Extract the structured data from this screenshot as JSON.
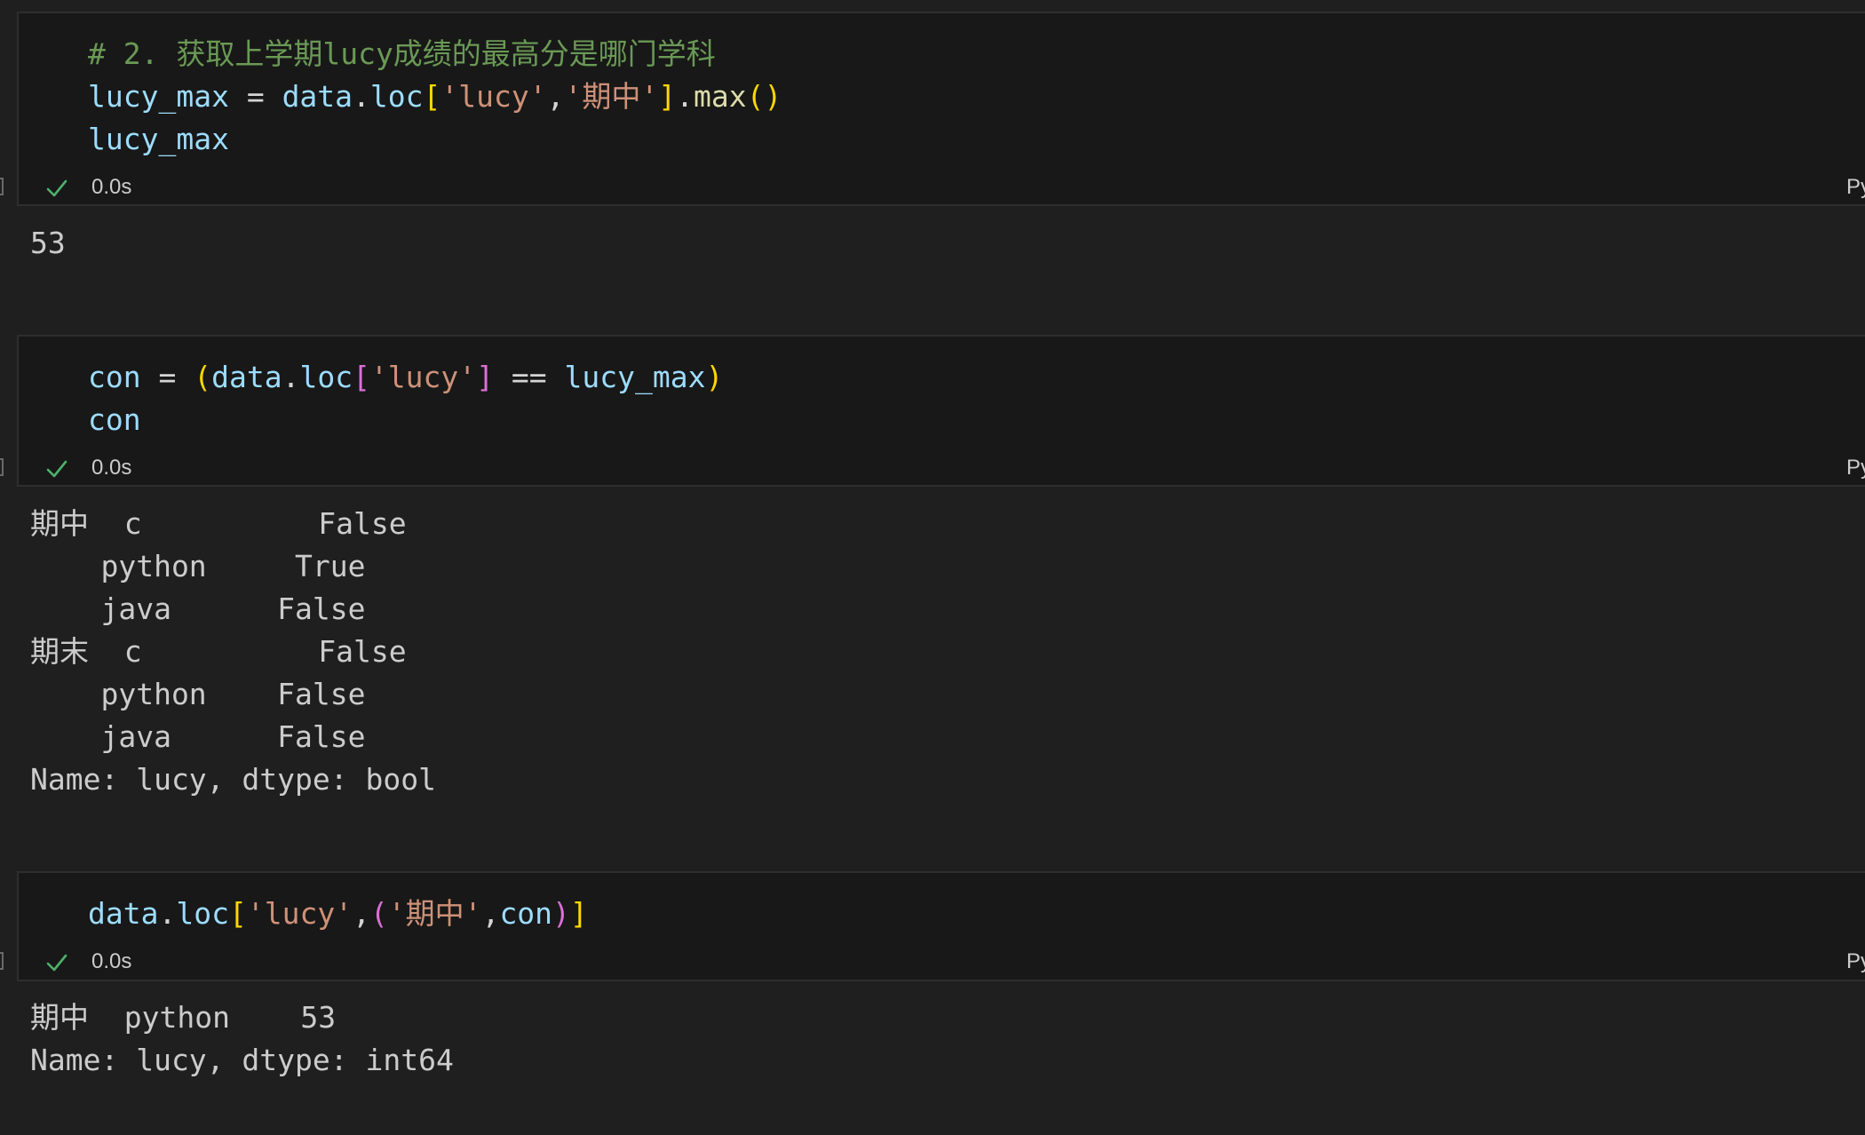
{
  "cells": [
    {
      "code_lines": [
        [
          {
            "text": "# 2. 获取上学期lucy成绩的最高分是哪门学科",
            "kind": "comment"
          }
        ],
        [
          {
            "text": "lucy_max",
            "kind": "var"
          },
          {
            "text": " = ",
            "kind": "op"
          },
          {
            "text": "data",
            "kind": "var"
          },
          {
            "text": ".",
            "kind": "plain"
          },
          {
            "text": "loc",
            "kind": "var"
          },
          {
            "text": "[",
            "kind": "b1"
          },
          {
            "text": "'lucy'",
            "kind": "str"
          },
          {
            "text": ",",
            "kind": "plain"
          },
          {
            "text": "'期中'",
            "kind": "str"
          },
          {
            "text": "]",
            "kind": "b1"
          },
          {
            "text": ".",
            "kind": "plain"
          },
          {
            "text": "max",
            "kind": "fn"
          },
          {
            "text": "()",
            "kind": "b1"
          }
        ],
        [
          {
            "text": "lucy_max",
            "kind": "var"
          }
        ]
      ],
      "status": {
        "elapsed": "0.0s",
        "language": "Py"
      },
      "output_lines": [
        "53"
      ]
    },
    {
      "code_lines": [
        [
          {
            "text": "con",
            "kind": "var"
          },
          {
            "text": " = ",
            "kind": "op"
          },
          {
            "text": "(",
            "kind": "b1"
          },
          {
            "text": "data",
            "kind": "var"
          },
          {
            "text": ".",
            "kind": "plain"
          },
          {
            "text": "loc",
            "kind": "var"
          },
          {
            "text": "[",
            "kind": "b2"
          },
          {
            "text": "'lucy'",
            "kind": "str"
          },
          {
            "text": "]",
            "kind": "b2"
          },
          {
            "text": " == ",
            "kind": "op"
          },
          {
            "text": "lucy_max",
            "kind": "var"
          },
          {
            "text": ")",
            "kind": "b1"
          }
        ],
        [
          {
            "text": "con",
            "kind": "var"
          }
        ]
      ],
      "status": {
        "elapsed": "0.0s",
        "language": "Py"
      },
      "output_lines": [
        "期中  c          False",
        "    python     True",
        "    java      False",
        "期末  c          False",
        "    python    False",
        "    java      False",
        "Name: lucy, dtype: bool"
      ]
    },
    {
      "code_lines": [
        [
          {
            "text": "data",
            "kind": "var"
          },
          {
            "text": ".",
            "kind": "plain"
          },
          {
            "text": "loc",
            "kind": "var"
          },
          {
            "text": "[",
            "kind": "b1"
          },
          {
            "text": "'lucy'",
            "kind": "str"
          },
          {
            "text": ",",
            "kind": "plain"
          },
          {
            "text": "(",
            "kind": "b2"
          },
          {
            "text": "'期中'",
            "kind": "str"
          },
          {
            "text": ",",
            "kind": "plain"
          },
          {
            "text": "con",
            "kind": "var"
          },
          {
            "text": ")",
            "kind": "b2"
          },
          {
            "text": "]",
            "kind": "b1"
          }
        ]
      ],
      "status": {
        "elapsed": "0.0s",
        "language": "Py"
      },
      "output_lines": [
        "期中  python    53",
        "Name: lucy, dtype: int64"
      ]
    }
  ]
}
